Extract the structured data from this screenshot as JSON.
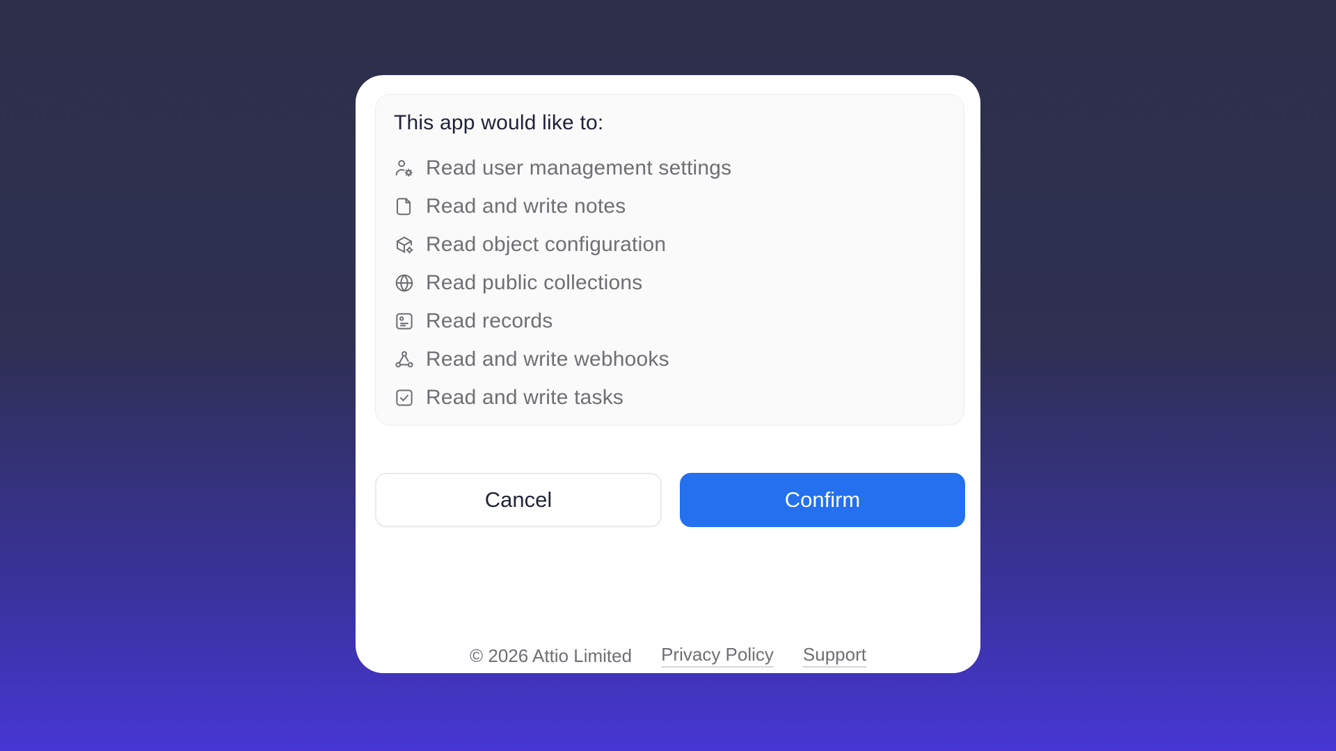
{
  "permissions": {
    "title": "This app would like to:",
    "items": [
      {
        "icon": "user-settings-icon",
        "label": "Read user management settings"
      },
      {
        "icon": "note-icon",
        "label": "Read and write notes"
      },
      {
        "icon": "object-config-icon",
        "label": "Read object configuration"
      },
      {
        "icon": "globe-icon",
        "label": "Read public collections"
      },
      {
        "icon": "record-icon",
        "label": "Read records"
      },
      {
        "icon": "webhook-icon",
        "label": "Read and write webhooks"
      },
      {
        "icon": "task-checkbox-icon",
        "label": "Read and write tasks"
      }
    ]
  },
  "actions": {
    "cancel_label": "Cancel",
    "confirm_label": "Confirm"
  },
  "footer": {
    "copyright": "© 2026 Attio Limited",
    "privacy_label": "Privacy Policy",
    "support_label": "Support"
  },
  "colors": {
    "primary": "#2470ee",
    "background_top": "#2d2f4a",
    "background_bottom": "#4736d4"
  }
}
